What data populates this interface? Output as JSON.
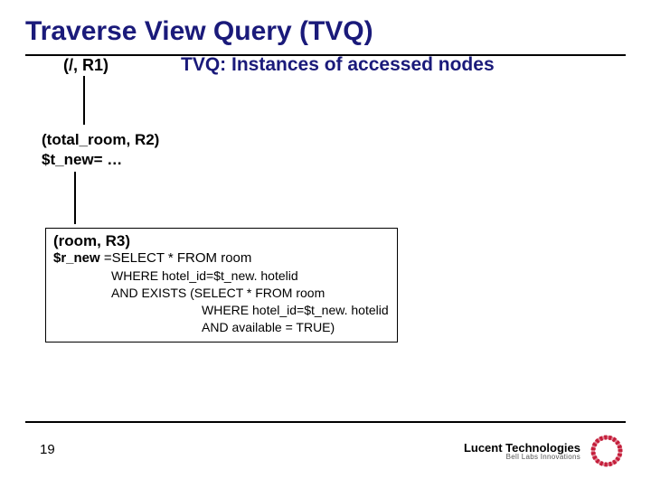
{
  "title": "Traverse View Query (TVQ)",
  "subtitle": "TVQ: Instances of accessed nodes",
  "nodes": {
    "root": {
      "label": "(/, R1)"
    },
    "mid": {
      "line1": "(total_room, R2)",
      "line2": "$t_new= …"
    },
    "leaf": {
      "line1": "(room, R3)",
      "var_prefix": "$r_new ",
      "sql_head": "=SELECT * FROM room",
      "sql_l1": "WHERE hotel_id=$t_new. hotelid",
      "sql_l2": "AND EXISTS (SELECT * FROM room",
      "sql_l3": "WHERE hotel_id=$t_new. hotelid",
      "sql_l4": "AND available = TRUE)"
    }
  },
  "page_number": "19",
  "brand": {
    "name": "Lucent Technologies",
    "tagline": "Bell Labs Innovations"
  },
  "colors": {
    "title": "#1a1a7a",
    "logo": "#c41e3a"
  }
}
